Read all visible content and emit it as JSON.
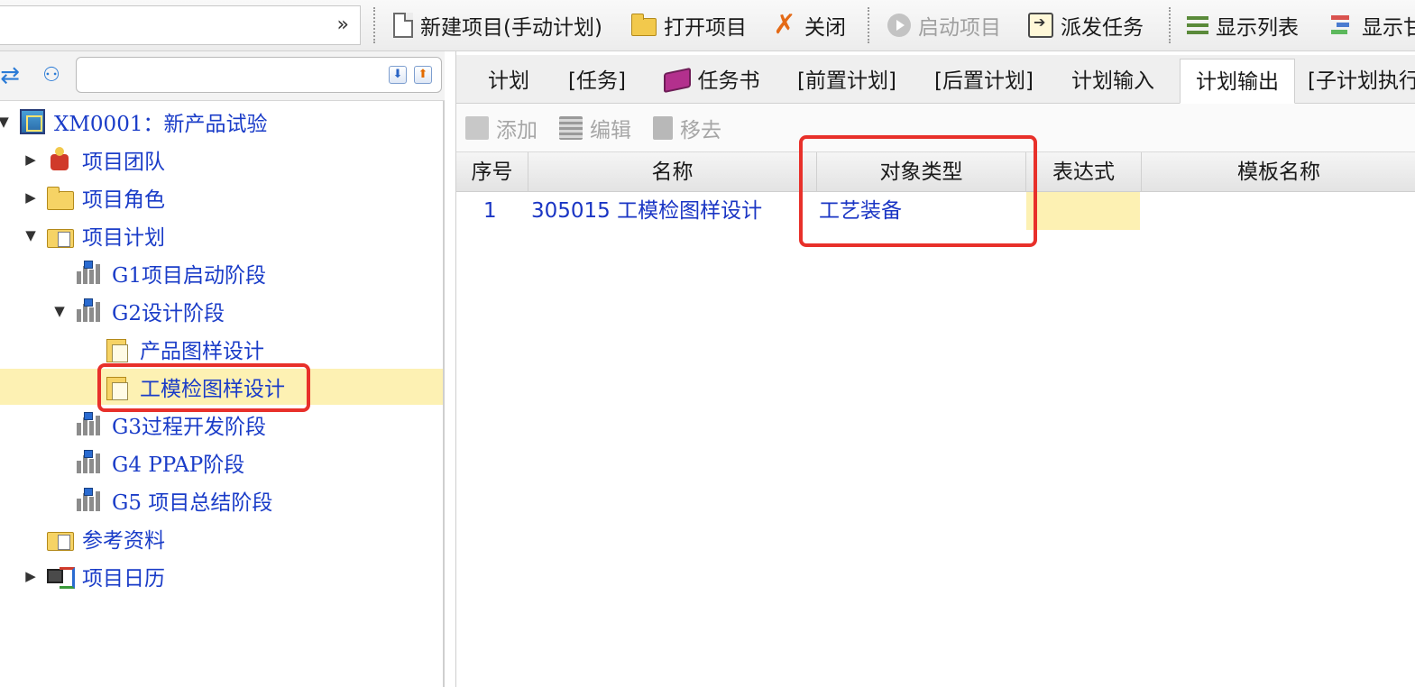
{
  "toolbar": {
    "combo_value": "",
    "buttons": [
      {
        "label": "新建项目(手动计划)",
        "icon": "new-document-icon",
        "enabled": true
      },
      {
        "label": "打开项目",
        "icon": "open-folder-icon",
        "enabled": true
      },
      {
        "label": "关闭",
        "icon": "close-icon",
        "enabled": true
      },
      {
        "label": "启动项目",
        "icon": "play-icon",
        "enabled": false
      },
      {
        "label": "派发任务",
        "icon": "dispatch-icon",
        "enabled": true
      },
      {
        "label": "显示列表",
        "icon": "list-icon",
        "enabled": true
      },
      {
        "label": "显示甘",
        "icon": "gantt-icon",
        "enabled": true
      }
    ]
  },
  "left": {
    "search_value": "",
    "tree": [
      {
        "label": "XM0001：新产品试验",
        "icon": "project-icon",
        "expanded": true
      },
      {
        "label": "项目团队",
        "icon": "team-icon",
        "expanded": false
      },
      {
        "label": "项目角色",
        "icon": "folder-icon",
        "expanded": false
      },
      {
        "label": "项目计划",
        "icon": "folder-doc-icon",
        "expanded": true
      },
      {
        "label": "G1项目启动阶段",
        "icon": "stage-icon"
      },
      {
        "label": "G2设计阶段",
        "icon": "stage-icon",
        "expanded": true
      },
      {
        "label": "产品图样设计",
        "icon": "task-icon"
      },
      {
        "label": "工模检图样设计",
        "icon": "task-icon",
        "selected": true
      },
      {
        "label": "G3过程开发阶段",
        "icon": "stage-icon"
      },
      {
        "label": "G4 PPAP阶段",
        "icon": "stage-icon"
      },
      {
        "label": "G5 项目总结阶段",
        "icon": "stage-icon"
      },
      {
        "label": "参考资料",
        "icon": "folder-doc-icon"
      },
      {
        "label": "项目日历",
        "icon": "calendar-icon",
        "expanded": false
      }
    ]
  },
  "right": {
    "tabs": [
      "计划",
      "[任务]",
      "任务书",
      "[前置计划]",
      "[后置计划]",
      "计划输入",
      "计划输出",
      "[子计划执行]"
    ],
    "active_tab": "计划输出",
    "subtools": [
      "添加",
      "编辑",
      "移去"
    ],
    "grid": {
      "columns": [
        "序号",
        "名称",
        "对象类型",
        "表达式",
        "模板名称"
      ],
      "rows": [
        {
          "no": "1",
          "name": "305015 工模检图样设计",
          "type": "工艺装备",
          "expr": "",
          "template": ""
        }
      ]
    }
  },
  "colors": {
    "highlight": "#e8302a",
    "selection": "#fdf1b3",
    "link": "#1a35c4"
  }
}
